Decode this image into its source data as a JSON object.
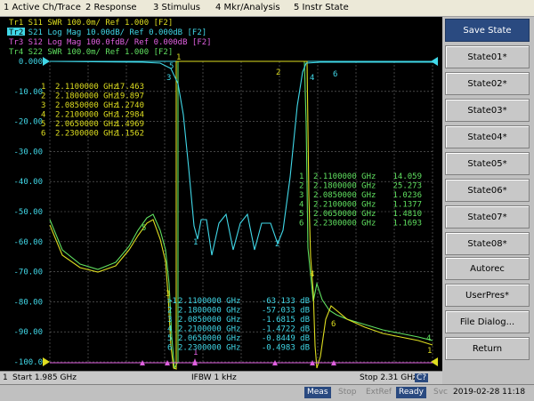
{
  "menu": [
    "1 Active Ch/Trace",
    "2 Response",
    "3 Stimulus",
    "4 Mkr/Analysis",
    "5 Instr State"
  ],
  "traces": [
    {
      "label": "Tr1",
      "line": " S11  SWR 100.0m/ Ref 1.000 [F2]",
      "color": "#dede20"
    },
    {
      "label": "Tr2",
      "line": " S21  Log Mag 10.00dB/ Ref 0.000dB [F2]",
      "color": "#40d8e8"
    },
    {
      "label": "Tr3",
      "line": " S12  Log Mag 100.0fdB/ Ref 0.000dB [F2]",
      "color": "#e060e0"
    },
    {
      "label": "Tr4",
      "line": " S22  SWR 100.0m/ Ref 1.000 [F2]",
      "color": "#60e060"
    }
  ],
  "y_axis": [
    "0.000",
    "-10.00",
    "-20.00",
    "-30.00",
    "-40.00",
    "-50.00",
    "-60.00",
    "-70.00",
    "-80.00",
    "-90.00",
    "-100.0"
  ],
  "marker_table_1": [
    [
      "1",
      "2.1100000 GHz",
      "17.463"
    ],
    [
      "2",
      "2.1800000 GHz",
      "19.897"
    ],
    [
      "3",
      "2.0850000 GHz",
      "1.2740"
    ],
    [
      "4",
      "2.2100000 GHz",
      "1.2984"
    ],
    [
      "5",
      "2.0650000 GHz",
      "1.4969"
    ],
    [
      "6",
      "2.2300000 GHz",
      "1.1562"
    ]
  ],
  "marker_table_2": [
    [
      "1",
      "2.1100000 GHz",
      "14.059"
    ],
    [
      "2",
      "2.1800000 GHz",
      "25.273"
    ],
    [
      "3",
      "2.0850000 GHz",
      "1.0236"
    ],
    [
      "4",
      "2.2100000 GHz",
      "1.1377"
    ],
    [
      "5",
      "2.0650000 GHz",
      "1.4810"
    ],
    [
      "6",
      "2.2300000 GHz",
      "1.1693"
    ]
  ],
  "marker_table_3": [
    [
      ">1",
      "2.1100000 GHz",
      "-63.133 dB"
    ],
    [
      "2",
      "2.1800000 GHz",
      "-57.033 dB"
    ],
    [
      "3",
      "2.0850000 GHz",
      "-1.6815 dB"
    ],
    [
      "4",
      "2.2100000 GHz",
      "-1.4722 dB"
    ],
    [
      "5",
      "2.0650000 GHz",
      "-0.8449 dB"
    ],
    [
      "6",
      "2.2300000 GHz",
      "-0.4983 dB"
    ]
  ],
  "status": {
    "channel": "1",
    "start": "Start 1.985 GHz",
    "ifbw": "IFBW 1 kHz",
    "stop": "Stop 2.31 GHz",
    "cal": "C?"
  },
  "bottom": {
    "meas": "Meas",
    "stop": "Stop",
    "extref": "ExtRef",
    "ready": "Ready",
    "svc": "Svc",
    "datetime": "2019-02-28 11:18"
  },
  "softkeys": [
    "Save State",
    "State01*",
    "State02*",
    "State03*",
    "State04*",
    "State05*",
    "State06*",
    "State07*",
    "State08*",
    "Autorec",
    "UserPres*",
    "File Dialog...",
    "Return"
  ],
  "colors": {
    "screen_bg": "#000000",
    "grid": "#6e6e6e",
    "s11": "#dede20",
    "s21": "#40d8e8",
    "s12": "#e060e0",
    "s22": "#60e060",
    "softkey_title": "#2a4a80"
  }
}
